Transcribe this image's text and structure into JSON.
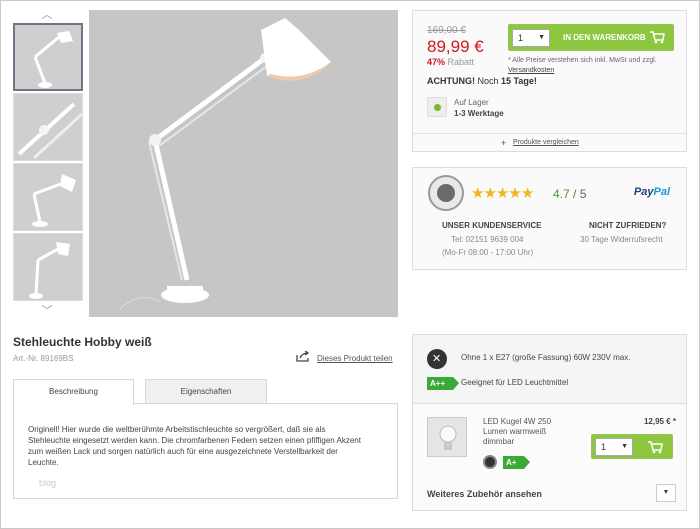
{
  "gallery": {
    "thumb_count": 4
  },
  "price": {
    "old": "169,00 €",
    "new": "89,99 €",
    "discount_percent": "47%",
    "discount_label": "Rabatt",
    "qty": "1",
    "cart_label": "IN DEN WARENKORB",
    "note": "* Alle Preise verstehen sich inkl. MwSt und zzgl.",
    "shipping_link": "Versandkosten",
    "achtung_prefix": "ACHTUNG!",
    "achtung_middle": "Noch",
    "achtung_days": "15 Tage!",
    "stock_status": "Auf Lager",
    "stock_time": "1-3 Werktage",
    "compare_link": "Produkte vergleichen"
  },
  "service": {
    "rating_score": "4.7",
    "rating_max": "/ 5",
    "rating_value": 4.7,
    "paypal_a": "Pay",
    "paypal_b": "Pal",
    "kundenservice_title": "UNSER KUNDENSERVICE",
    "phone": "Tel: 02151 9639 004",
    "hours": "(Mo-Fr 08:00 - 17:00 Uhr)",
    "unzufrieden_title": "NICHT ZUFRIEDEN?",
    "return": "30 Tage Widerrufsrecht"
  },
  "product": {
    "title": "Stehleuchte Hobby weiß",
    "art_nr": "Art.-Nr. 89169BS",
    "share_link": "Dieses Produkt teilen"
  },
  "tabs": {
    "description": "Beschreibung",
    "properties": "Eigenschaften"
  },
  "description": {
    "text": "Originell! Hier wurde die weltberühmte Arbeitstischleuchte so vergrößert, daß sie als Stehleuchte eingesetzt werden kann. Die chromfarbenen Federn setzen einen pfiffigen Akzent zum weißen Lack und sorgen natürlich auch für eine ausgezeichnete Verstellbarkeit der Leuchte.",
    "blog": "blog"
  },
  "accessory": {
    "bulb_info": "Ohne 1 x E27 (große Fassung) 60W 230V max.",
    "energy_class": "A++",
    "led_info": "Geeignet für LED Leuchtmittel",
    "item_name": "LED Kugel 4W 250 Lumen warmweiß dimmbar",
    "item_price": "12,95 € *",
    "item_qty": "1",
    "item_energy": "A+",
    "more_label": "Weiteres Zubehör ansehen"
  },
  "colors": {
    "accent_green": "#8dc63f",
    "price_red": "#d1171d",
    "star_gold": "#f1b722"
  }
}
